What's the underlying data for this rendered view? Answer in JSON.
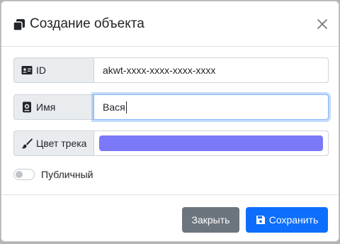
{
  "modal": {
    "title": "Создание объекта",
    "title_icon": "objects-icon",
    "close_icon": "close-icon"
  },
  "fields": {
    "id": {
      "label": "ID",
      "icon": "id-card-icon",
      "value": "akwt-xxxx-xxxx-xxxx-xxxx"
    },
    "name": {
      "label": "Имя",
      "icon": "user-badge-icon",
      "value": "Вася"
    },
    "track_color": {
      "label": "Цвет трека",
      "icon": "brush-icon",
      "color": "#7b79f7"
    }
  },
  "public_switch": {
    "label": "Публичный",
    "checked": false
  },
  "footer": {
    "close_label": "Закрыть",
    "save_label": "Сохранить",
    "save_icon": "floppy-disk-icon"
  },
  "colors": {
    "primary": "#0d6efd",
    "secondary": "#6c757d",
    "addon_bg": "#e9ecef"
  }
}
